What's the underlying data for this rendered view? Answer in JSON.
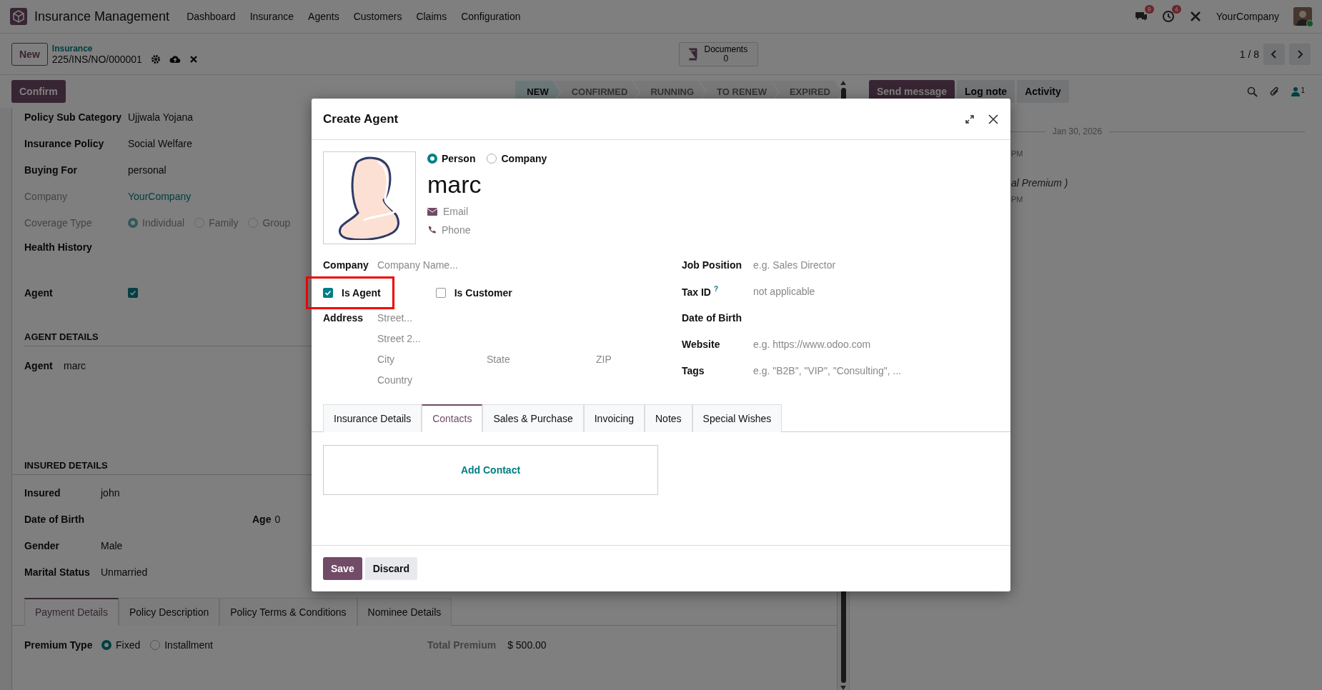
{
  "navbar": {
    "app_name": "Insurance Management",
    "menu": [
      "Dashboard",
      "Insurance",
      "Agents",
      "Customers",
      "Claims",
      "Configuration"
    ],
    "messages_count": "9",
    "activities_count": "4",
    "company": "YourCompany"
  },
  "control_panel": {
    "new_button": "New",
    "breadcrumb": "Insurance",
    "record": "225/INS/NO/000001",
    "documents": {
      "label": "Documents",
      "count": "0"
    },
    "pager": "1 / 8"
  },
  "status_row": {
    "confirm_button": "Confirm",
    "stages": [
      {
        "label": "NEW",
        "selected": true
      },
      {
        "label": "CONFIRMED",
        "selected": false
      },
      {
        "label": "RUNNING",
        "selected": false
      },
      {
        "label": "TO RENEW",
        "selected": false
      },
      {
        "label": "EXPIRED",
        "selected": false
      }
    ],
    "chatter_buttons": [
      {
        "label": "Send message",
        "kind": "primary"
      },
      {
        "label": "Log note",
        "kind": "secondary"
      },
      {
        "label": "Activity",
        "kind": "secondary"
      }
    ],
    "followers_count": "1"
  },
  "form": {
    "top_fields": [
      {
        "kind": "text",
        "label": "Policy Sub Category",
        "value": "Ujjwala Yojana",
        "readonly": false
      },
      {
        "kind": "text",
        "label": "Insurance Policy",
        "value": "Social Welfare",
        "readonly": false
      },
      {
        "kind": "text",
        "label": "Buying For",
        "value": "personal",
        "readonly": false
      },
      {
        "kind": "link",
        "label": "Company",
        "value": "YourCompany",
        "readonly": true
      },
      {
        "kind": "radio",
        "label": "Coverage Type",
        "readonly": true,
        "options": [
          {
            "label": "Individual",
            "selected": true
          },
          {
            "label": "Family",
            "selected": false
          },
          {
            "label": "Group",
            "selected": false
          }
        ]
      },
      {
        "kind": "empty",
        "label": "Health History",
        "readonly": false
      },
      {
        "kind": "checkbox",
        "label": "Agent",
        "checked": true,
        "readonly": false
      }
    ],
    "agent_section": {
      "title": "AGENT DETAILS",
      "fields": [
        {
          "label": "Agent",
          "value": "marc"
        }
      ]
    },
    "insured_section": {
      "title": "INSURED DETAILS",
      "fields": [
        {
          "label": "Insured",
          "value": "john"
        },
        {
          "label": "Date of Birth",
          "side_label": "Age",
          "side_value": "0"
        },
        {
          "label": "Gender",
          "value": "Male"
        },
        {
          "label": "Marital Status",
          "value": "Unmarried"
        }
      ]
    },
    "notebook": {
      "tabs": [
        {
          "label": "Payment Details",
          "selected": true
        },
        {
          "label": "Policy Description",
          "selected": false
        },
        {
          "label": "Policy Terms & Conditions",
          "selected": false
        },
        {
          "label": "Nominee Details",
          "selected": false
        }
      ],
      "premium_type": {
        "label": "Premium Type",
        "options": [
          {
            "label": "Fixed",
            "selected": true
          },
          {
            "label": "Installment",
            "selected": false
          }
        ]
      },
      "total_premium": {
        "label": "Total Premium",
        "value": "$ 500.00"
      }
    }
  },
  "chatter": {
    "date": "Jan 30, 2026",
    "fragments": [
      {
        "kind": "meta",
        "text": "PM"
      },
      {
        "kind": "body",
        "text": "al Premium )"
      },
      {
        "kind": "meta",
        "text": "PM"
      }
    ]
  },
  "dialog": {
    "title": "Create Agent",
    "company_type": [
      {
        "label": "Person",
        "selected": true
      },
      {
        "label": "Company",
        "selected": false
      }
    ],
    "name": "marc",
    "email": {
      "placeholder": "Email"
    },
    "phone": {
      "placeholder": "Phone"
    },
    "company": {
      "label": "Company",
      "placeholder": "Company Name..."
    },
    "flags": [
      {
        "label": "Is Agent",
        "checked": true,
        "highlighted": true
      },
      {
        "label": "Is Customer",
        "checked": false,
        "highlighted": false
      }
    ],
    "address": {
      "label": "Address",
      "street": {
        "placeholder": "Street..."
      },
      "street2": {
        "placeholder": "Street 2..."
      },
      "city": {
        "placeholder": "City"
      },
      "state": {
        "placeholder": "State"
      },
      "zip": {
        "placeholder": "ZIP"
      },
      "country": {
        "placeholder": "Country"
      }
    },
    "right_fields": [
      {
        "label": "Job Position",
        "placeholder": "e.g. Sales Director"
      },
      {
        "label": "Tax ID",
        "help": "?",
        "placeholder": "not applicable"
      },
      {
        "label": "Date of Birth"
      },
      {
        "label": "Website",
        "placeholder": "e.g. https://www.odoo.com"
      },
      {
        "label": "Tags",
        "placeholder": "e.g. \"B2B\", \"VIP\", \"Consulting\", ..."
      }
    ],
    "tabs": [
      {
        "label": "Insurance Details",
        "selected": false
      },
      {
        "label": "Contacts",
        "selected": true
      },
      {
        "label": "Sales & Purchase",
        "selected": false
      },
      {
        "label": "Invoicing",
        "selected": false
      },
      {
        "label": "Notes",
        "selected": false
      },
      {
        "label": "Special Wishes",
        "selected": false
      }
    ],
    "add_contact": "Add Contact",
    "save_button": "Save",
    "discard_button": "Discard"
  }
}
